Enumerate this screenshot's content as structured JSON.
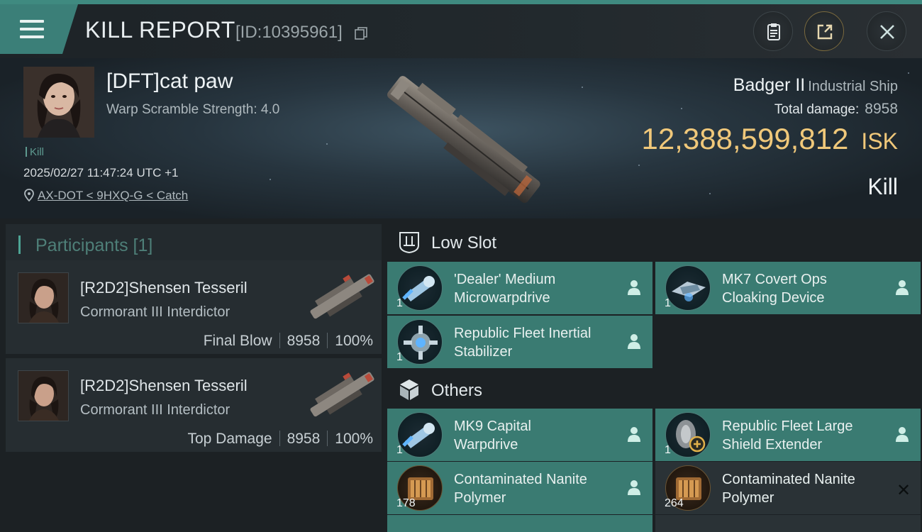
{
  "header": {
    "title": "KILL REPORT",
    "report_id": "[ID:10395961]"
  },
  "victim": {
    "name": "[DFT]cat paw",
    "warp_scramble": "Warp Scramble Strength: 4.0",
    "tag": "Kill",
    "datetime": "2025/02/27 11:47:24 UTC +1",
    "location": "AX-DOT < 9HXQ-G < Catch",
    "ship_name": "Badger II",
    "ship_class": "Industrial Ship",
    "total_damage_label": "Total damage:",
    "total_damage_value": "8958",
    "isk_value": "12,388,599,812",
    "isk_unit": "ISK",
    "result": "Kill"
  },
  "participants": {
    "label": "Participants [1]",
    "items": [
      {
        "name": "[R2D2]Shensen Tesseril",
        "ship": "Cormorant III Interdictor",
        "role": "Final Blow",
        "damage": "8958",
        "percent": "100%"
      },
      {
        "name": "[R2D2]Shensen Tesseril",
        "ship": "Cormorant III Interdictor",
        "role": "Top Damage",
        "damage": "8958",
        "percent": "100%"
      }
    ]
  },
  "sections": {
    "low_slot": "Low Slot",
    "others": "Others"
  },
  "modules": [
    {
      "name_l1": "'Dealer' Medium",
      "name_l2": "Microwarpdrive",
      "qty": "1"
    },
    {
      "name_l1": "MK7 Covert Ops",
      "name_l2": "Cloaking Device",
      "qty": "1"
    },
    {
      "name_l1": "Republic Fleet Inertial",
      "name_l2": "Stabilizer",
      "qty": "1"
    },
    {
      "name_l1": "MK9 Capital",
      "name_l2": "Warpdrive",
      "qty": "1"
    },
    {
      "name_l1": "Republic Fleet Large",
      "name_l2": "Shield Extender",
      "qty": "1"
    },
    {
      "name_l1": "Contaminated Nanite",
      "name_l2": "Polymer",
      "qty": "178"
    },
    {
      "name_l1": "Contaminated Nanite",
      "name_l2": "Polymer",
      "qty": "264"
    }
  ],
  "colors": {
    "accent_teal": "#3a7b72",
    "isk_gold": "#f0c87a",
    "header_teal": "#3b7f78"
  }
}
